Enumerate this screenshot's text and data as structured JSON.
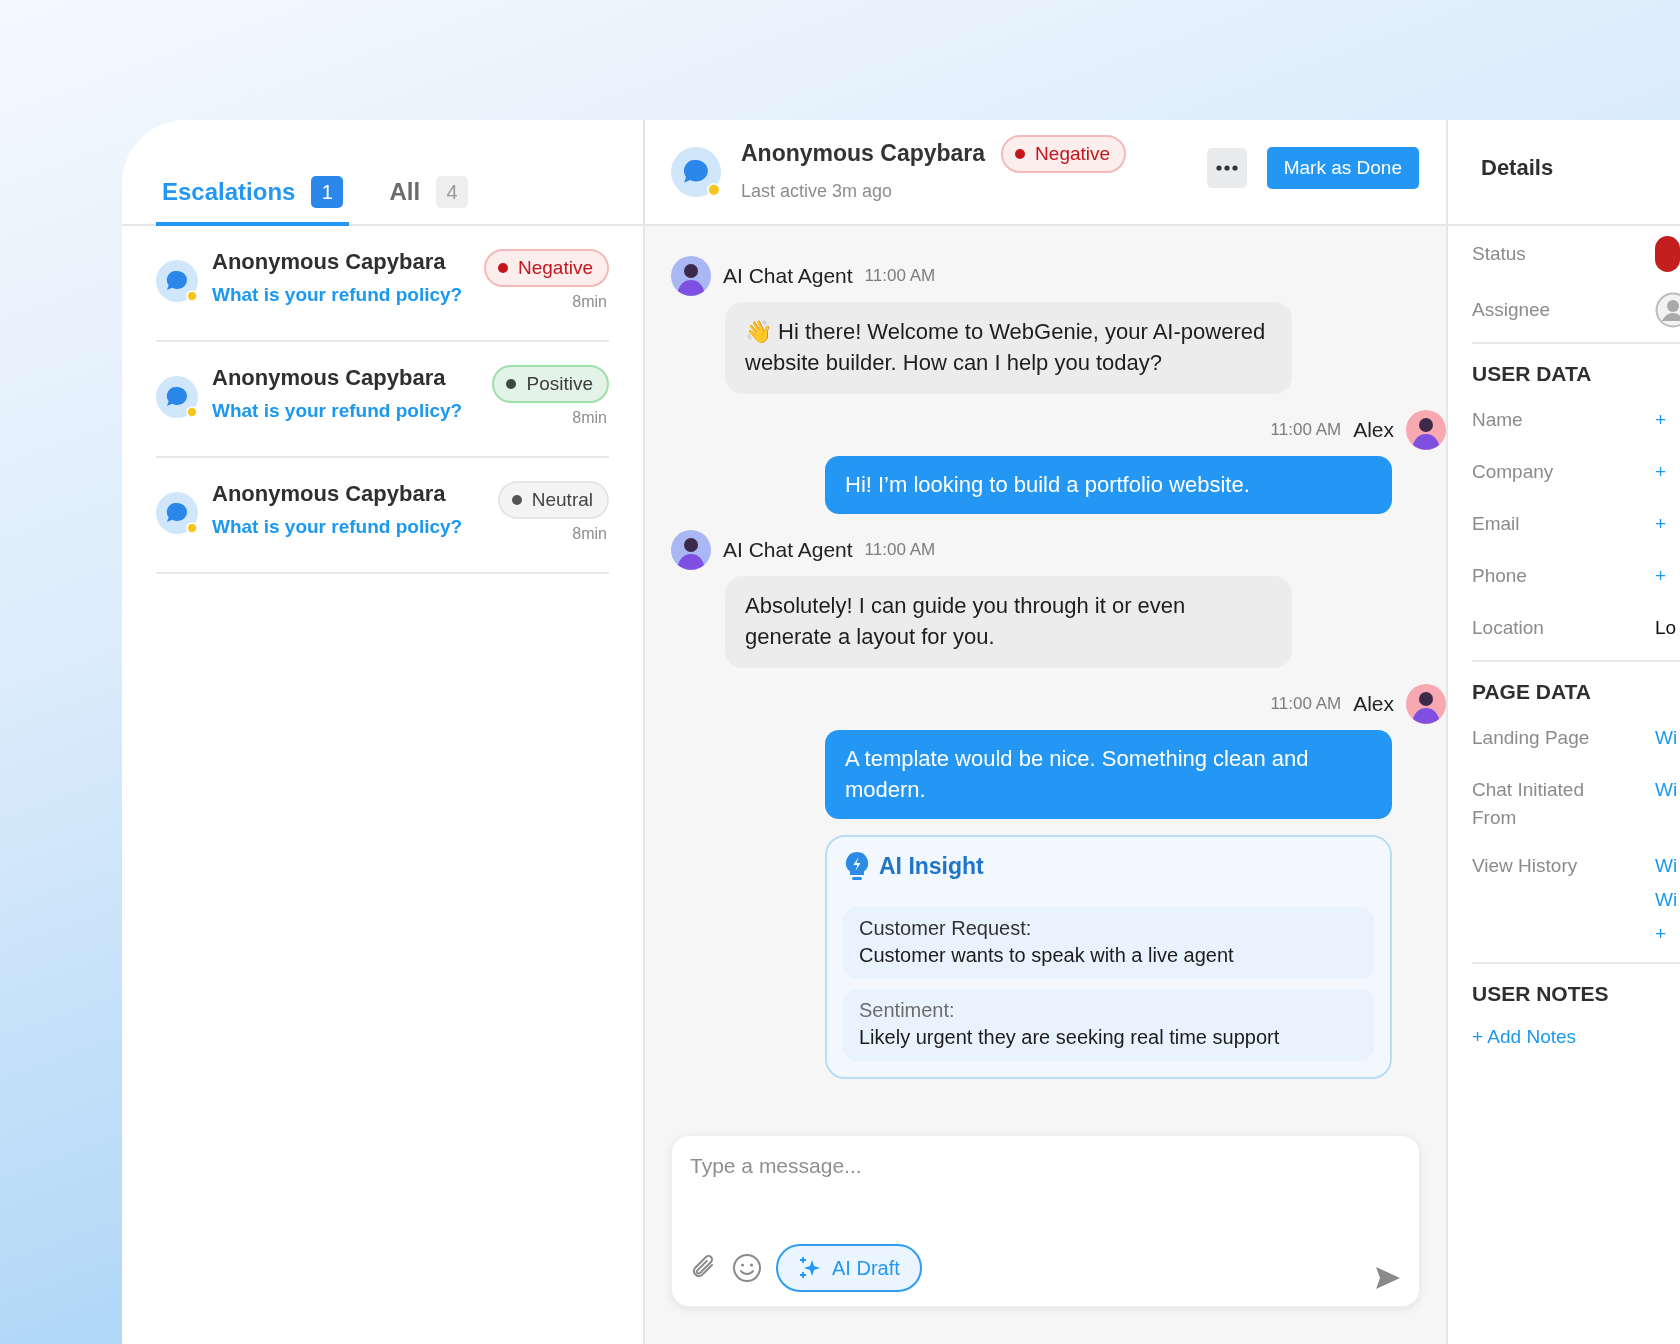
{
  "conversation_list": {
    "tabs": [
      {
        "label": "Escalations",
        "count": "1",
        "selected": true
      },
      {
        "label": "All",
        "count": "4",
        "selected": false
      }
    ],
    "items": [
      {
        "name": "Anonymous Capybara",
        "preview": "What is your refund policy?",
        "sentiment": {
          "label": "Negative",
          "kind": "negative"
        },
        "time": "8min"
      },
      {
        "name": "Anonymous Capybara",
        "preview": "What is your refund policy?",
        "sentiment": {
          "label": "Positive",
          "kind": "positive"
        },
        "time": "8min"
      },
      {
        "name": "Anonymous Capybara",
        "preview": "What is your refund policy?",
        "sentiment": {
          "label": "Neutral",
          "kind": "neutral"
        },
        "time": "8min"
      }
    ]
  },
  "chat_header": {
    "name": "Anonymous Capybara",
    "sentiment": {
      "label": "Negative",
      "kind": "negative"
    },
    "last_active": "Last active 3m ago",
    "primary_button": "Mark as Done"
  },
  "messages": [
    {
      "kind": "agent",
      "sender": "AI Chat Agent",
      "time": "11:00 AM",
      "text": "👋 Hi there! Welcome to WebGenie, your AI-powered website builder. How can I help you today?"
    },
    {
      "kind": "user",
      "sender": "Alex",
      "time": "11:00 AM",
      "text": "Hi! I’m looking to build a portfolio website."
    },
    {
      "kind": "agent",
      "sender": "AI Chat Agent",
      "time": "11:00 AM",
      "text": "Absolutely! I can guide you through it or even generate a layout for you."
    },
    {
      "kind": "user",
      "sender": "Alex",
      "time": "11:00 AM",
      "text": "A template would be nice. Something clean and modern."
    },
    {
      "kind": "insight",
      "title": "AI Insight",
      "sections": [
        {
          "label": "Customer Request:",
          "text": "Customer wants to speak with a live agent"
        },
        {
          "label": "Sentiment:",
          "text": "Likely urgent they are seeking real time support"
        }
      ]
    }
  ],
  "composer": {
    "placeholder": "Type a message...",
    "ai_button": "AI Draft"
  },
  "details": {
    "title": "Details",
    "top_rows": [
      {
        "label": "Status",
        "kind": "status"
      },
      {
        "label": "Assignee",
        "kind": "assignee"
      }
    ],
    "sections": [
      {
        "title": "USER DATA",
        "rows": [
          {
            "label": "Name",
            "values": [
              {
                "kind": "link",
                "text": "+"
              }
            ]
          },
          {
            "label": "Company",
            "values": [
              {
                "kind": "link",
                "text": "+"
              }
            ]
          },
          {
            "label": "Email",
            "values": [
              {
                "kind": "link",
                "text": "+"
              }
            ]
          },
          {
            "label": "Phone",
            "values": [
              {
                "kind": "link",
                "text": "+"
              }
            ]
          },
          {
            "label": "Location",
            "values": [
              {
                "kind": "text",
                "text": "Lo"
              }
            ]
          }
        ]
      },
      {
        "title": "PAGE DATA",
        "rows": [
          {
            "label": "Landing Page",
            "values": [
              {
                "kind": "link",
                "text": "Wi"
              }
            ]
          },
          {
            "label": "Chat Initiated From",
            "values": [
              {
                "kind": "link",
                "text": "Wi"
              }
            ]
          },
          {
            "label": "View History",
            "values": [
              {
                "kind": "link",
                "text": "Wi"
              },
              {
                "kind": "link",
                "text": "Wi"
              },
              {
                "kind": "link",
                "text": "+"
              }
            ]
          }
        ]
      },
      {
        "title": "USER NOTES",
        "link": "+ Add Notes"
      }
    ]
  }
}
